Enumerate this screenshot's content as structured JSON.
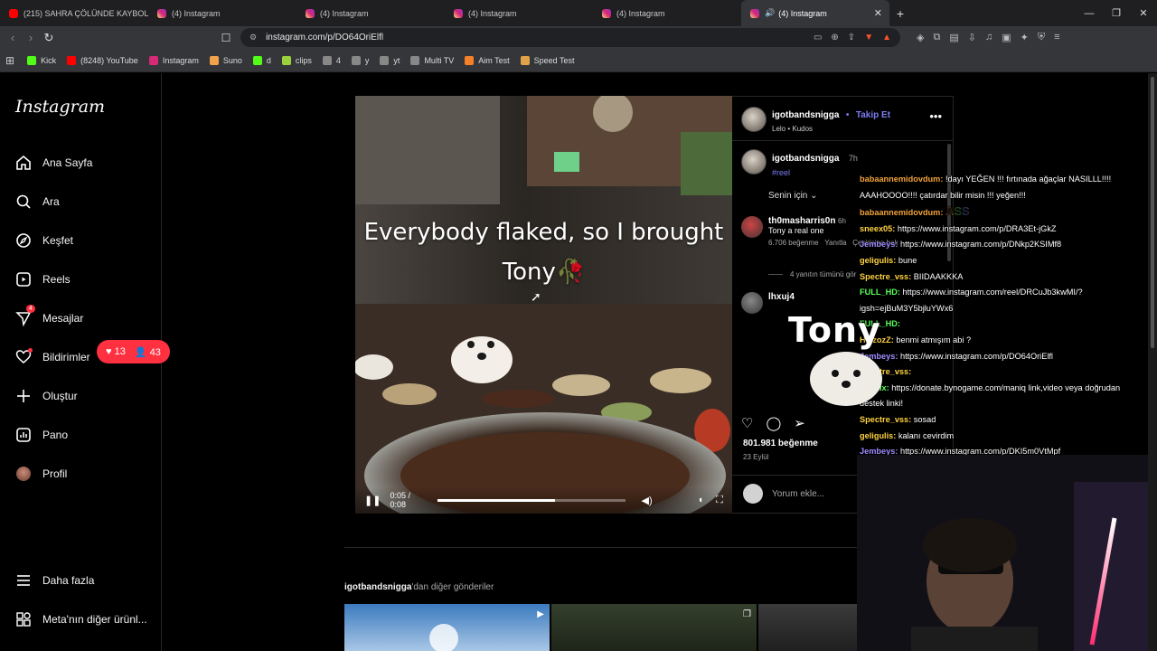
{
  "browser": {
    "tabs": [
      {
        "title": "(215) SAHRA ÇÖLÜNDE KAYBOLAN E",
        "favicon": "youtube-icon",
        "active": false
      },
      {
        "title": "(4) Instagram",
        "favicon": "instagram-icon",
        "active": false
      },
      {
        "title": "(4) Instagram",
        "favicon": "instagram-icon",
        "active": false
      },
      {
        "title": "(4) Instagram",
        "favicon": "instagram-icon",
        "active": false
      },
      {
        "title": "(4) Instagram",
        "favicon": "instagram-icon",
        "active": false
      },
      {
        "title": "(4) Instagram",
        "favicon": "instagram-icon",
        "active": true
      }
    ],
    "url": "instagram.com/p/DO64OriElfl",
    "bookmarks": [
      {
        "label": "Kick",
        "color": "#53fc18"
      },
      {
        "label": "(8248) YouTube",
        "color": "#ff0000"
      },
      {
        "label": "Instagram",
        "color": "#d62976"
      },
      {
        "label": "Suno",
        "color": "#f2a24b"
      },
      {
        "label": "d",
        "color": "#53fc18"
      },
      {
        "label": "clips",
        "color": "#9bd23c"
      },
      {
        "label": "4",
        "color": "#888888"
      },
      {
        "label": "y",
        "color": "#888888"
      },
      {
        "label": "yt",
        "color": "#888888"
      },
      {
        "label": "Multi TV",
        "color": "#888888"
      },
      {
        "label": "Aim Test",
        "color": "#f5822a"
      },
      {
        "label": "Speed Test",
        "color": "#e0a34a"
      }
    ]
  },
  "sidebar": {
    "logo": "Instagram",
    "items": [
      {
        "label": "Ana Sayfa",
        "icon": "home-icon"
      },
      {
        "label": "Ara",
        "icon": "search-icon"
      },
      {
        "label": "Keşfet",
        "icon": "compass-icon"
      },
      {
        "label": "Reels",
        "icon": "reels-icon"
      },
      {
        "label": "Mesajlar",
        "icon": "messenger-icon"
      },
      {
        "label": "Bildirimler",
        "icon": "heart-icon"
      },
      {
        "label": "Oluştur",
        "icon": "plus-icon"
      },
      {
        "label": "Pano",
        "icon": "dashboard-icon"
      },
      {
        "label": "Profil",
        "icon": "avatar"
      }
    ],
    "messages_badge": "4",
    "notif_likes": "13",
    "notif_follows": "43",
    "more_label": "Daha fazla",
    "meta_label": "Meta'nın diğer ürünl..."
  },
  "post": {
    "overlay_line1": "Everybody flaked, so I brought",
    "overlay_line2": "Tony",
    "overlay_emoji": "🥀",
    "time_current": "0:05",
    "time_total": "0:08",
    "progress": 0.625,
    "author": "igotbandsnigga",
    "separator": "•",
    "follow_label": "Takip Et",
    "subline": "Lelo • Kudos",
    "caption_user": "igotbandsnigga",
    "caption_time": "7h",
    "hashtag": "#reel",
    "sort_label": "Senin için",
    "comments": [
      {
        "user": "th0masharris0n",
        "time": "6h",
        "text": "Tony a real one",
        "likes": "6.706 beğenme",
        "reply": "Yanıtla",
        "translate": "Çevirisine bak"
      },
      {
        "user": "lhxuj4",
        "time": "",
        "text": "",
        "likes": "",
        "reply": "",
        "translate": ""
      }
    ],
    "replies_label": "4 yanıtın tümünü gör",
    "likes_count": "801.981 beğenme",
    "date": "23 Eylül",
    "add_comment_placeholder": "Yorum ekle..."
  },
  "more_posts": {
    "user": "igotbandsnigga",
    "suffix": "'dan diğer gönderiler"
  },
  "chat": [
    {
      "user": "babaannemidovdum",
      "color": "#f2a33a",
      "sep": ":",
      "text": "!dayı YEĞEN !!! fırtınada ağaçlar NASILLL!!!! AAAHOOOO!!!! çatırdar bilir misin !!! yeğen!!!"
    },
    {
      "user": "babaannemidovdum",
      "color": "#f2a33a",
      "sep": ":",
      "text": "ASS"
    },
    {
      "user": "sneex05",
      "color": "#ffd23f",
      "sep": ":",
      "text": "https://www.instagram.com/p/DRA3Et-jGkZ"
    },
    {
      "user": "Jembeys",
      "color": "#9f8cff",
      "sep": ":",
      "text": "https://www.instagram.com/p/DNkp2KSIMf8"
    },
    {
      "user": "geligulis",
      "color": "#ffd23f",
      "sep": ":",
      "text": "bune"
    },
    {
      "user": "Spectre_vss",
      "color": "#ffd23f",
      "sep": ":",
      "text": "BIIDAAKKKA"
    },
    {
      "user": "FULL_HD",
      "color": "#5cff5c",
      "sep": ":",
      "text": "https://www.instagram.com/reel/DRCuJb3kwMI/?igsh=ejBuM3Y5bjluYWx6"
    },
    {
      "user": "FULL_HD",
      "color": "#5cff5c",
      "sep": ":",
      "text": ""
    },
    {
      "user": "HeizozZ",
      "color": "#ffd23f",
      "sep": ":",
      "text": "benmi atmışım abi ?"
    },
    {
      "user": "Jembeys",
      "color": "#9f8cff",
      "sep": ":",
      "text": "https://www.instagram.com/p/DO64OriElfl"
    },
    {
      "user": "Spectre_vss",
      "color": "#ffd23f",
      "sep": ":",
      "text": ""
    },
    {
      "user": "BotRix",
      "color": "#5cff5c",
      "sep": ":",
      "text": "https://donate.bynogame.com/maniq link,video veya doğrudan destek linki!"
    },
    {
      "user": "Spectre_vss",
      "color": "#ffd23f",
      "sep": ":",
      "text": "sosad"
    },
    {
      "user": "geligulis",
      "color": "#ffd23f",
      "sep": ":",
      "text": "kalanı cevirdim"
    },
    {
      "user": "Jembeys",
      "color": "#9f8cff",
      "sep": ":",
      "text": "https://www.instagram.com/p/DKI5m0VtMpf"
    }
  ],
  "tony_emote": "Tony"
}
